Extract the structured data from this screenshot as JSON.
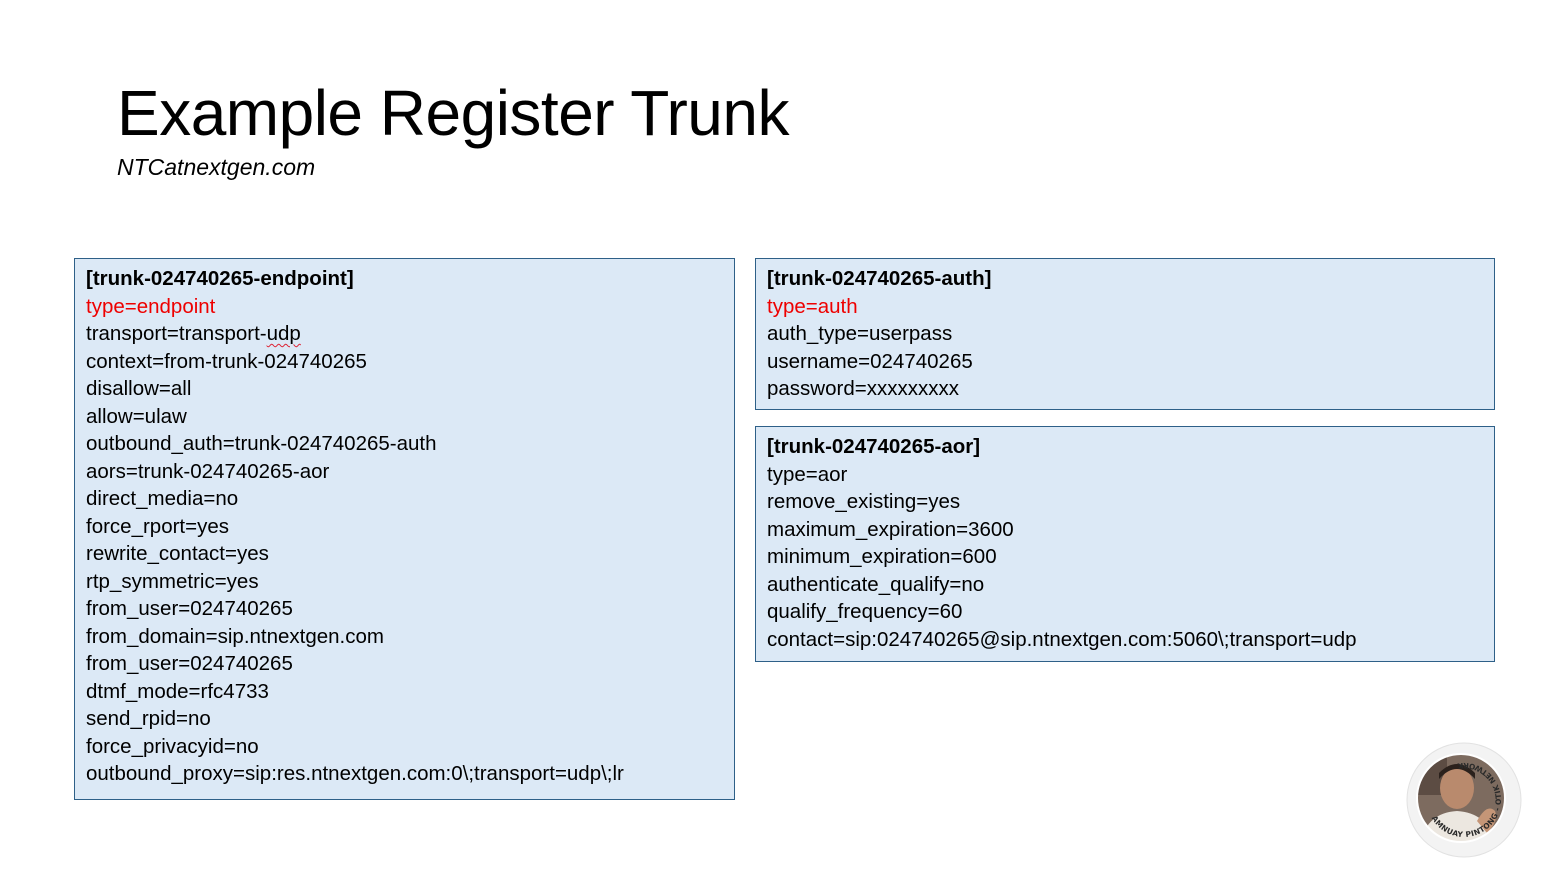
{
  "slide": {
    "title": "Example Register Trunk",
    "subtitle": "NTCatnextgen.com"
  },
  "endpoint_box": {
    "header": "[trunk-024740265-endpoint]",
    "type_line": "type=endpoint",
    "transport_prefix": "transport=transport-",
    "transport_suffix": "udp",
    "lines": [
      "context=from-trunk-024740265",
      "disallow=all",
      "allow=ulaw",
      "outbound_auth=trunk-024740265-auth",
      "aors=trunk-024740265-aor",
      "direct_media=no",
      "force_rport=yes",
      "rewrite_contact=yes",
      "rtp_symmetric=yes",
      "from_user=024740265",
      "from_domain=sip.ntnextgen.com",
      "from_user=024740265",
      "dtmf_mode=rfc4733",
      "send_rpid=no",
      "force_privacyid=no",
      "outbound_proxy=sip:res.ntnextgen.com:0\\;transport=udp\\;lr"
    ]
  },
  "auth_box": {
    "header": "[trunk-024740265-auth]",
    "type_line": "type=auth",
    "lines": [
      "auth_type=userpass",
      "username=024740265",
      "password=xxxxxxxxx"
    ]
  },
  "aor_box": {
    "header": "[trunk-024740265-aor]",
    "lines": [
      "type=aor",
      "remove_existing=yes",
      "maximum_expiration=3600",
      "minimum_expiration=600",
      "authenticate_qualify=no",
      "qualify_frequency=60",
      "contact=sip:024740265@sip.ntnextgen.com:5060\\;transport=udp"
    ]
  },
  "badge": {
    "text": "AMNUAY PINTONG - OTIK NETWORK",
    "icon": "profile-photo-badge"
  },
  "colors": {
    "box_fill": "#dce9f6",
    "box_border": "#2e6088",
    "type_highlight": "#ee0000"
  }
}
